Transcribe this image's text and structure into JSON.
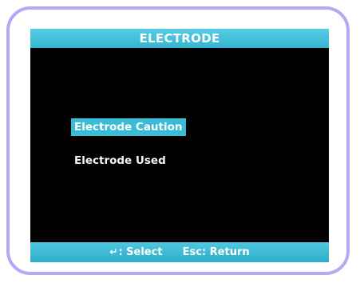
{
  "header": {
    "title": "ELECTRODE"
  },
  "menu": {
    "items": [
      {
        "label": "Electrode Caution",
        "selected": true
      },
      {
        "label": "Electrode Used",
        "selected": false
      }
    ]
  },
  "footer": {
    "select_icon": "enter-key-icon",
    "select_label": ": Select",
    "return_label": "Esc: Return"
  },
  "colors": {
    "frame": "#b1abf5",
    "accent": "#3bbcd6",
    "screen": "#000000",
    "text": "#ffffff"
  }
}
